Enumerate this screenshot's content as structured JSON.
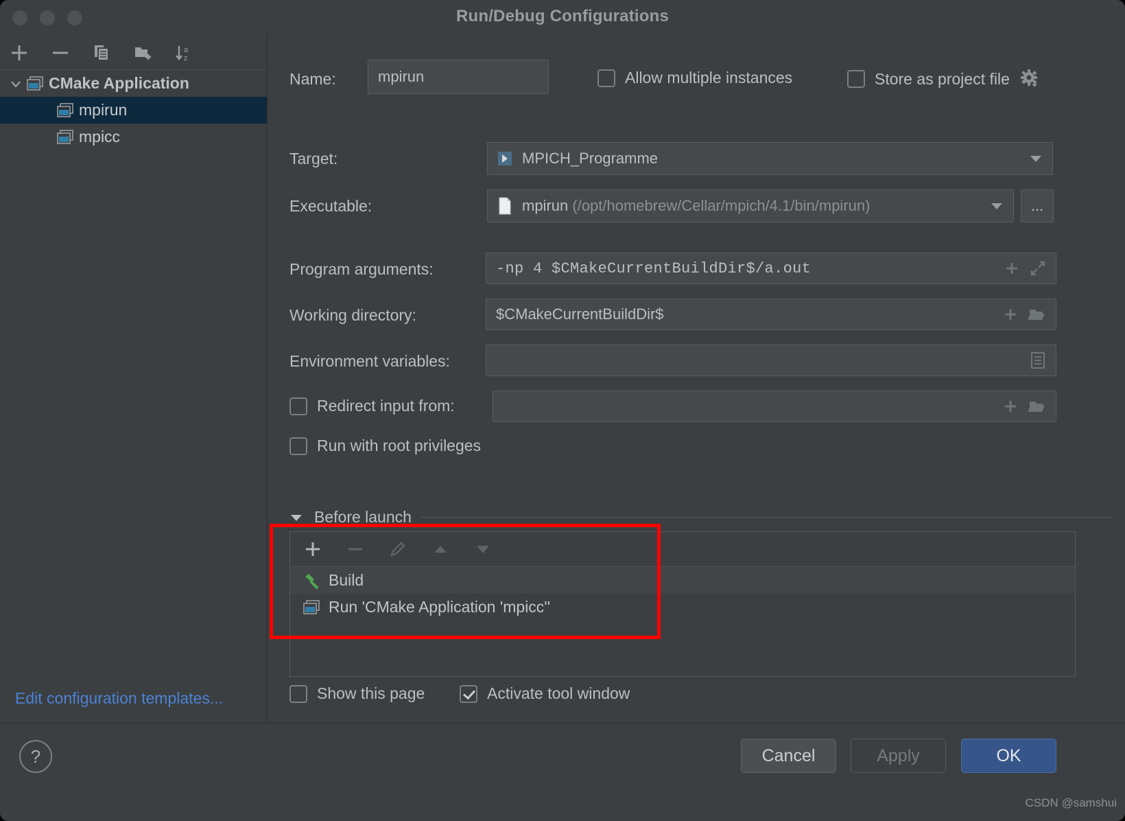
{
  "window": {
    "title": "Run/Debug Configurations"
  },
  "sidebar": {
    "toolbar": [
      {
        "name": "add-configuration-button",
        "icon": "plus-icon",
        "label": "+"
      },
      {
        "name": "remove-configuration-button",
        "icon": "minus-icon",
        "label": "−"
      },
      {
        "name": "copy-configuration-button",
        "icon": "copy-icon",
        "label": "copy"
      },
      {
        "name": "new-folder-button",
        "icon": "folder-add-icon",
        "label": "new folder"
      },
      {
        "name": "sort-configurations-button",
        "icon": "sort-alpha-icon",
        "label": "sort a-z"
      }
    ],
    "tree": {
      "root": {
        "label": "CMake Application",
        "icon": "cmake-application-icon",
        "expanded": true
      },
      "items": [
        {
          "label": "mpirun",
          "icon": "run-configuration-icon",
          "selected": true
        },
        {
          "label": "mpicc",
          "icon": "run-configuration-icon",
          "selected": false
        }
      ]
    },
    "edit_templates_link": "Edit configuration templates..."
  },
  "form": {
    "name": {
      "label": "Name:",
      "value": "mpirun"
    },
    "allow_multiple_instances": {
      "label": "Allow multiple instances",
      "checked": false
    },
    "store_as_project_file": {
      "label": "Store as project file",
      "checked": false,
      "gear_icon": "gear-dropdown-icon"
    },
    "target": {
      "label": "Target:",
      "value": "MPICH_Programme",
      "icon": "target-run-icon"
    },
    "executable": {
      "label": "Executable:",
      "value": "mpirun",
      "path": "(/opt/homebrew/Cellar/mpich/4.1/bin/mpirun)",
      "icon": "file-icon",
      "browse_label": "..."
    },
    "program_arguments": {
      "label": "Program arguments:",
      "value": "-np 4 $CMakeCurrentBuildDir$/a.out",
      "icons": [
        "insert-macro-icon",
        "expand-icon"
      ]
    },
    "working_directory": {
      "label": "Working directory:",
      "value": "$CMakeCurrentBuildDir$",
      "icons": [
        "insert-macro-icon",
        "browse-folder-icon"
      ]
    },
    "environment_variables": {
      "label": "Environment variables:",
      "value": "",
      "icons": [
        "edit-env-list-icon"
      ]
    },
    "redirect_input_from": {
      "label": "Redirect input from:",
      "checked": false,
      "value": "",
      "icons": [
        "insert-macro-icon",
        "browse-folder-icon"
      ]
    },
    "run_with_root_privileges": {
      "label": "Run with root privileges",
      "checked": false
    }
  },
  "before_launch": {
    "title": "Before launch",
    "expanded": true,
    "toolbar": [
      {
        "name": "add-task-button",
        "icon": "plus-icon",
        "label": "+",
        "enabled": true
      },
      {
        "name": "remove-task-button",
        "icon": "minus-icon",
        "label": "−",
        "enabled": false
      },
      {
        "name": "edit-task-button",
        "icon": "pencil-icon",
        "label": "edit",
        "enabled": false
      },
      {
        "name": "move-up-button",
        "icon": "arrow-up-icon",
        "label": "up",
        "enabled": false
      },
      {
        "name": "move-down-button",
        "icon": "arrow-down-icon",
        "label": "down",
        "enabled": false
      }
    ],
    "tasks": [
      {
        "label": "Build",
        "icon": "hammer-icon"
      },
      {
        "label": "Run 'CMake Application 'mpicc''",
        "icon": "run-configuration-icon"
      }
    ],
    "highlight_color": "#fe0000"
  },
  "footer_options": {
    "show_this_page": {
      "label": "Show this page",
      "checked": false
    },
    "activate_tool_window": {
      "label": "Activate tool window",
      "checked": true
    }
  },
  "buttons": {
    "help": "?",
    "cancel": "Cancel",
    "apply": "Apply",
    "ok": "OK"
  },
  "watermark": "CSDN @samshui"
}
